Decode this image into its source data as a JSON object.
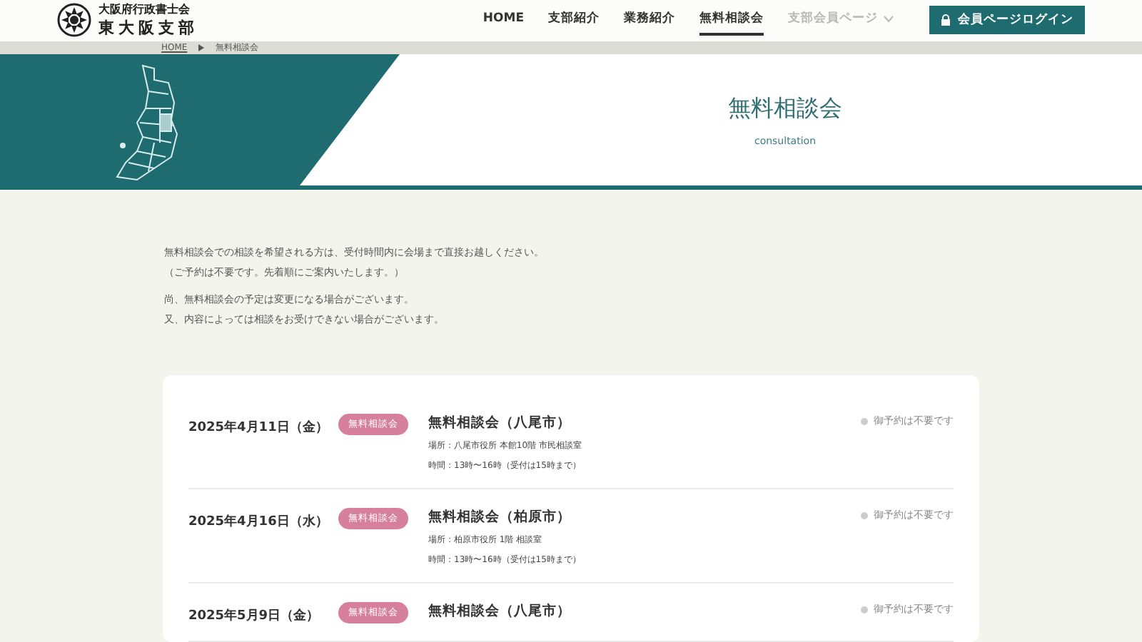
{
  "logo": {
    "line1": "大阪府行政書士会",
    "line2": "東大阪支部"
  },
  "nav": [
    {
      "label": "HOME",
      "selected": false,
      "disabled": false,
      "dropdown": false
    },
    {
      "label": "支部紹介",
      "selected": false,
      "disabled": false,
      "dropdown": false
    },
    {
      "label": "業務紹介",
      "selected": false,
      "disabled": false,
      "dropdown": false
    },
    {
      "label": "無料相談会",
      "selected": true,
      "disabled": false,
      "dropdown": false
    },
    {
      "label": "支部会員ページ",
      "selected": false,
      "disabled": true,
      "dropdown": true
    }
  ],
  "login_button": "会員ページログイン",
  "breadcrumb": {
    "home": "HOME",
    "current": "無料相談会"
  },
  "hero": {
    "title": "無料相談会",
    "subtitle": "consultation"
  },
  "intro": [
    "無料相談会での相談を希望される方は、受付時間内に会場まで直接お越しください。",
    "（ご予約は不要です。先着順にご案内いたします。）",
    "尚、無料相談会の予定は変更になる場合がございます。",
    "又、内容によっては相談をお受けできない場合がございます。"
  ],
  "events": [
    {
      "date": "2025年4月11日（金）",
      "tag": "無料相談会",
      "title": "無料相談会（八尾市）",
      "place": "場所：八尾市役所 本館10階 市民相談室",
      "time": "時間：13時〜16時（受付は15時まで）",
      "note": "御予約は不要です"
    },
    {
      "date": "2025年4月16日（水）",
      "tag": "無料相談会",
      "title": "無料相談会（柏原市）",
      "place": "場所：柏原市役所 1階 相談室",
      "time": "時間：13時〜16時（受付は15時まで）",
      "note": "御予約は不要です"
    },
    {
      "date": "2025年5月9日（金）",
      "tag": "無料相談会",
      "title": "無料相談会（八尾市）",
      "note": "御予約は不要です"
    }
  ]
}
